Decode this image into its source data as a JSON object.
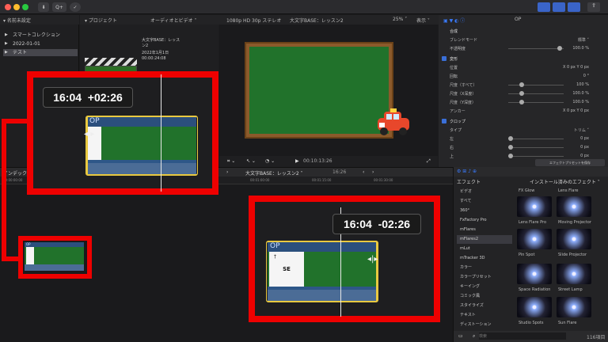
{
  "toolbar": {
    "badge": "✓",
    "btn_label": "Q+"
  },
  "headers": {
    "libraries": "▾ 名前未設定",
    "browser": "▾ プロジェクト (1)",
    "view_mode": "オーディオとビデオ ˅",
    "format": "1080p HD 30p ステレオ",
    "project": "大文字BASE：レッスン2",
    "zoom": "25% ˅",
    "display": "表示 ˅",
    "inspector_title": "OP"
  },
  "libraries": [
    {
      "label": "スマートコレクション",
      "selected": false
    },
    {
      "label": "2022-01-01",
      "selected": false
    },
    {
      "label": "テスト",
      "selected": true
    }
  ],
  "browser_clip": {
    "line1": "大文字BASE：レッス",
    "line2": "ン2",
    "line3": "2022年1月1日",
    "line4": "00:00:24:08"
  },
  "viewer": {
    "timecode": "00:10:13:26",
    "play": "▶"
  },
  "inspector": {
    "rows": [
      {
        "label": "合成",
        "value": "",
        "section": true
      },
      {
        "label": "ブレンドモード",
        "value": "標準 ˅"
      },
      {
        "label": "不透明度",
        "value": "100.0 %"
      },
      {
        "label": "変形",
        "value": "",
        "section": true
      },
      {
        "label": "位置",
        "value": "X 0 px  Y 0 px"
      },
      {
        "label": "回転",
        "value": "0 °"
      },
      {
        "label": "尺度（すべて）",
        "value": "100 %"
      },
      {
        "label": "尺度（X深度）",
        "value": "100.0 %"
      },
      {
        "label": "尺度（Y深度）",
        "value": "100.0 %"
      },
      {
        "label": "アンカー",
        "value": "X 0 px  Y 0 px"
      },
      {
        "label": "クロップ",
        "value": "",
        "section": true
      },
      {
        "label": "タイプ",
        "value": "トリム ˅"
      },
      {
        "label": "左",
        "value": "0 px"
      },
      {
        "label": "右",
        "value": "0 px"
      },
      {
        "label": "上",
        "value": "0 px"
      }
    ],
    "save_button": "エフェクトプリセットを保存"
  },
  "timeline": {
    "index_label": "インデックス",
    "project_menu": "大文字BASE：レッスン2 ˅",
    "duration": "16:26",
    "ruler": [
      "00:00:00:00",
      "00:00:15:00",
      "00:00:30:00",
      "00:00:45:00",
      "00:01:00:00",
      "00:01:15:00",
      "00:01:30:00"
    ],
    "clip_name": "OP",
    "white_frame_mark": "†",
    "white_frame_text": "SE"
  },
  "effects": {
    "title": "エフェクト",
    "filter": "インストール済みのエフェクト ˅",
    "categories": [
      {
        "label": "ビデオ",
        "selected": false
      },
      {
        "label": "すべて",
        "selected": false
      },
      {
        "label": "360°",
        "selected": false
      },
      {
        "label": "FxFactory Pro",
        "selected": false
      },
      {
        "label": "mFlares",
        "selected": false
      },
      {
        "label": "mFlares2",
        "selected": true
      },
      {
        "label": "mLut",
        "selected": false
      },
      {
        "label": "mTracker 3D",
        "selected": false
      },
      {
        "label": "カラー",
        "selected": false
      },
      {
        "label": "カラープリセット",
        "selected": false
      },
      {
        "label": "キーイング",
        "selected": false
      },
      {
        "label": "コミック風",
        "selected": false
      },
      {
        "label": "スタイライズ",
        "selected": false
      },
      {
        "label": "テキスト",
        "selected": false
      },
      {
        "label": "ディストーション",
        "selected": false
      }
    ],
    "items": [
      "FX Glow",
      "Lens Flare",
      "Lens Flare Pro",
      "Moving Projector",
      "Pin Spot",
      "Slide Projector",
      "Space Radiation",
      "Street Lamp",
      "Studio Spots",
      "Sun Flare"
    ],
    "count": "116項目",
    "search_placeholder": "検索"
  },
  "callouts": {
    "left_time": "16:04",
    "left_delta": "+02:26",
    "right_time": "16:04",
    "right_delta": "-02:26"
  },
  "colors": {
    "accent_red": "#ee0000",
    "clip_blue": "#2e5788",
    "video_green": "#21722b",
    "trim_yellow": "#e9c940"
  }
}
